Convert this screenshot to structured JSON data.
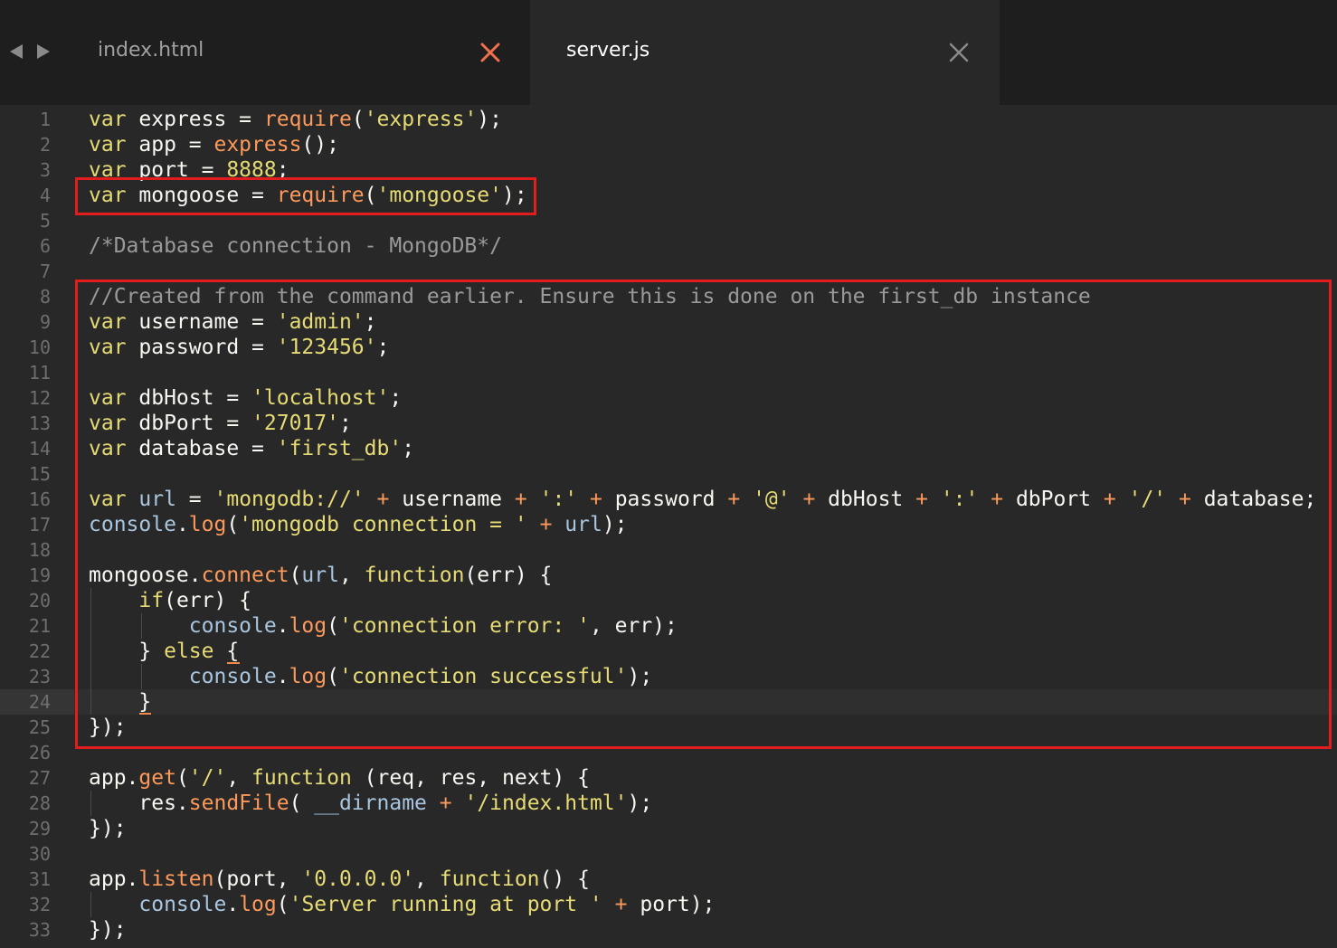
{
  "tabs": [
    {
      "label": "index.html",
      "active": false,
      "close_color": "#f0704e"
    },
    {
      "label": "server.js",
      "active": true,
      "close_color": "#8a8a8a"
    }
  ],
  "nav": {
    "back_icon": "triangle-left-icon",
    "forward_icon": "triangle-right-icon"
  },
  "colors": {
    "highlight_box": "#e11d1d",
    "keyword": "#e6db74",
    "function": "#fd9a5b",
    "comment": "#9a9a9a",
    "background": "#282828"
  },
  "current_line": 24,
  "lines": [
    {
      "n": "1",
      "code": "var express = require('express');"
    },
    {
      "n": "2",
      "code": "var app = express();"
    },
    {
      "n": "3",
      "code": "var port = 8888;"
    },
    {
      "n": "4",
      "code": "var mongoose = require('mongoose');"
    },
    {
      "n": "5",
      "code": ""
    },
    {
      "n": "6",
      "code": "/*Database connection - MongoDB*/"
    },
    {
      "n": "7",
      "code": ""
    },
    {
      "n": "8",
      "code": "//Created from the command earlier. Ensure this is done on the first_db instance"
    },
    {
      "n": "9",
      "code": "var username = 'admin';"
    },
    {
      "n": "10",
      "code": "var password = '123456';"
    },
    {
      "n": "11",
      "code": ""
    },
    {
      "n": "12",
      "code": "var dbHost = 'localhost';"
    },
    {
      "n": "13",
      "code": "var dbPort = '27017';"
    },
    {
      "n": "14",
      "code": "var database = 'first_db';"
    },
    {
      "n": "15",
      "code": ""
    },
    {
      "n": "16",
      "code": "var url = 'mongodb://' + username + ':' + password + '@' + dbHost + ':' + dbPort + '/' + database;"
    },
    {
      "n": "17",
      "code": "console.log('mongodb connection = ' + url);"
    },
    {
      "n": "18",
      "code": ""
    },
    {
      "n": "19",
      "code": "mongoose.connect(url, function(err) {"
    },
    {
      "n": "20",
      "code": "    if(err) {"
    },
    {
      "n": "21",
      "code": "        console.log('connection error: ', err);"
    },
    {
      "n": "22",
      "code": "    } else {"
    },
    {
      "n": "23",
      "code": "        console.log('connection successful');"
    },
    {
      "n": "24",
      "code": "    }"
    },
    {
      "n": "25",
      "code": "});"
    },
    {
      "n": "26",
      "code": ""
    },
    {
      "n": "27",
      "code": "app.get('/', function (req, res, next) {"
    },
    {
      "n": "28",
      "code": "    res.sendFile( __dirname + '/index.html');"
    },
    {
      "n": "29",
      "code": "});"
    },
    {
      "n": "30",
      "code": ""
    },
    {
      "n": "31",
      "code": "app.listen(port, '0.0.0.0', function() {"
    },
    {
      "n": "32",
      "code": "    console.log('Server running at port ' + port);"
    },
    {
      "n": "33",
      "code": "});"
    }
  ]
}
